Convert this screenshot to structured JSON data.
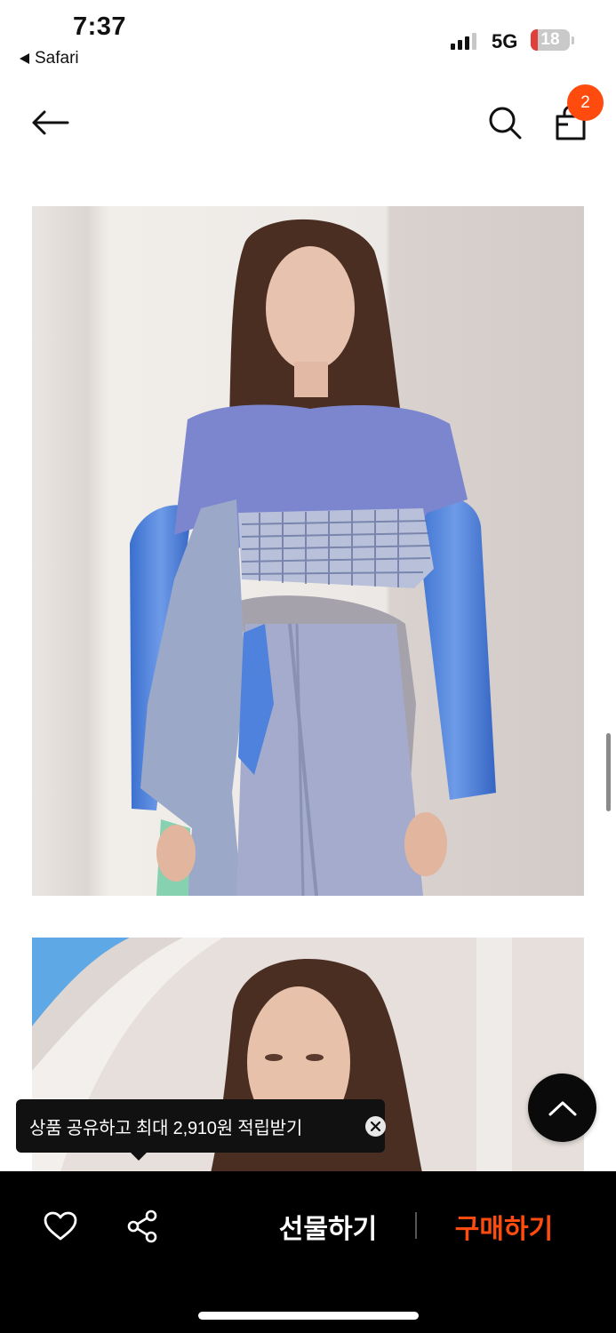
{
  "status_bar": {
    "time": "7:37",
    "back_app": "Safari",
    "network": "5G",
    "battery_level": 18,
    "battery_label": "18"
  },
  "header": {
    "back_icon": "arrow-left-icon",
    "search_icon": "search-icon",
    "cart_icon": "shopping-bag-icon",
    "cart_count": "2"
  },
  "gallery": {
    "images": [
      {
        "name": "product-photo-1",
        "alt": ""
      },
      {
        "name": "product-photo-2",
        "alt": ""
      }
    ]
  },
  "tooltip": {
    "text": "상품 공유하고 최대 2,910원 적립받기",
    "close_icon": "close-icon"
  },
  "bottom_bar": {
    "like_icon": "heart-icon",
    "share_icon": "share-icon",
    "gift_label": "선물하기",
    "buy_label": "구매하기"
  },
  "scroll_top_icon": "chevron-up-icon",
  "colors": {
    "accent": "#ff4c0e",
    "bar_background": "#000000",
    "tooltip_background": "#111111"
  }
}
